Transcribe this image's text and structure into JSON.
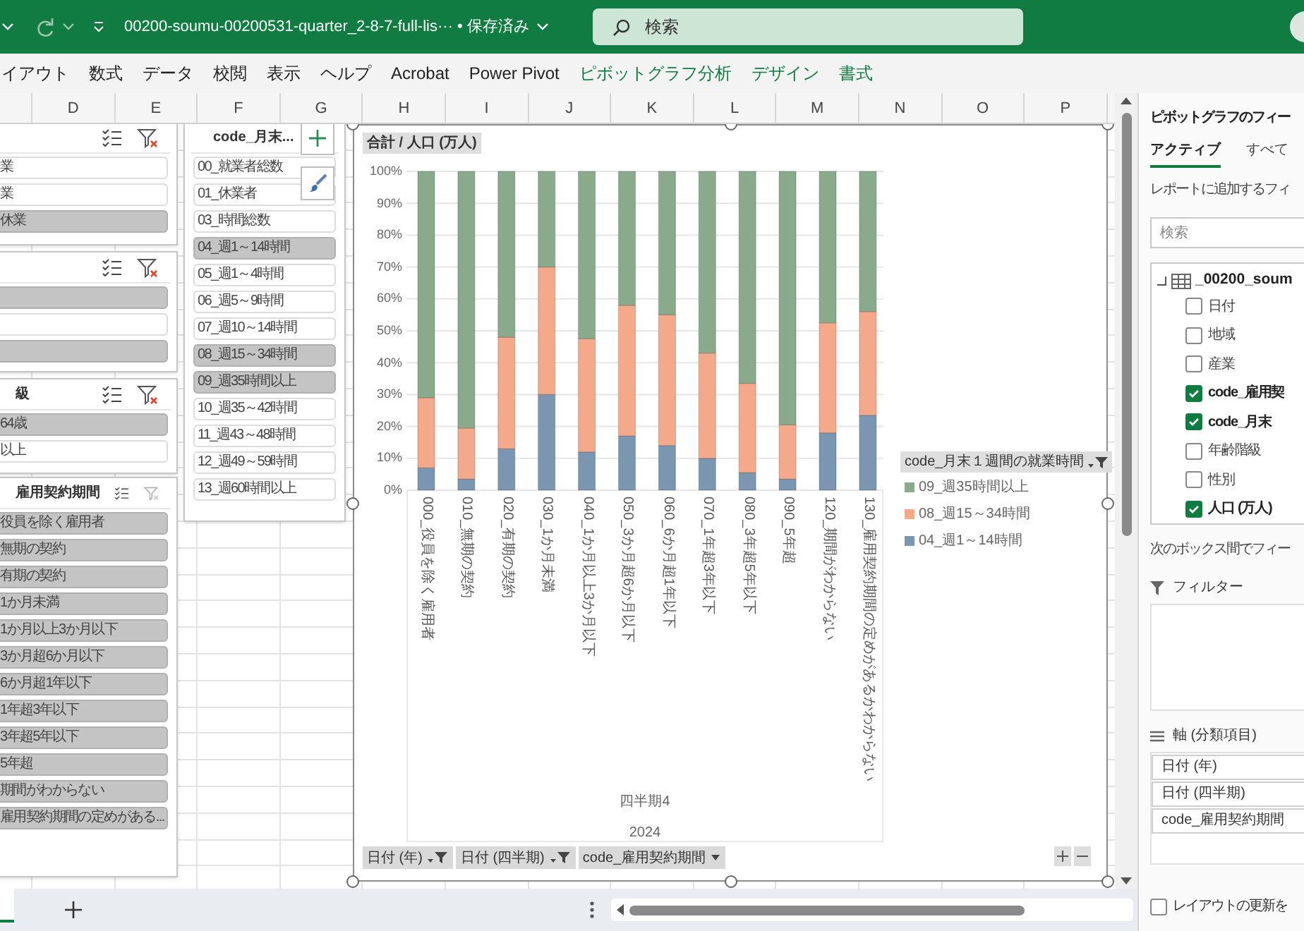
{
  "title_bar": {
    "file_name": "00200-soumu-00200531-quarter_2-8-7-full-lis···",
    "save_status": "• 保存済み",
    "search": {
      "placeholder": "検索"
    }
  },
  "ribbon_tabs": [
    {
      "label": "イアウト",
      "contextual": false
    },
    {
      "label": "数式",
      "contextual": false
    },
    {
      "label": "データ",
      "contextual": false
    },
    {
      "label": "校閲",
      "contextual": false
    },
    {
      "label": "表示",
      "contextual": false
    },
    {
      "label": "ヘルプ",
      "contextual": false
    },
    {
      "label": "Acrobat",
      "contextual": false
    },
    {
      "label": "Power Pivot",
      "contextual": false
    },
    {
      "label": "ピボットグラフ分析",
      "contextual": true
    },
    {
      "label": "デザイン",
      "contextual": true
    },
    {
      "label": "書式",
      "contextual": true
    }
  ],
  "column_headers": [
    "D",
    "E",
    "F",
    "G",
    "H",
    "I",
    "J",
    "K",
    "L",
    "M",
    "N",
    "O",
    "P"
  ],
  "slicers": [
    {
      "filtered": true,
      "items": [
        {
          "label": "業",
          "selected": false
        },
        {
          "label": "業",
          "selected": false
        },
        {
          "label": "休業",
          "selected": true
        }
      ]
    },
    {
      "filtered": true,
      "items": [
        {
          "selected": true
        },
        {
          "selected": false
        },
        {
          "selected": true
        }
      ]
    },
    {
      "header": "級",
      "filtered": true,
      "items": [
        {
          "label": "64歳",
          "selected": true
        },
        {
          "label": "以上",
          "selected": false
        }
      ]
    },
    {
      "header": "雇用契約期間",
      "filtered": false,
      "items": [
        {
          "label": "役員を除く雇用者",
          "selected": true
        },
        {
          "label": "無期の契約",
          "selected": true
        },
        {
          "label": "有期の契約",
          "selected": true
        },
        {
          "label": "1か月未満",
          "selected": true
        },
        {
          "label": "1か月以上3か月以下",
          "selected": true
        },
        {
          "label": "3か月超6か月以下",
          "selected": true
        },
        {
          "label": "6か月超1年以下",
          "selected": true
        },
        {
          "label": "1年超3年以下",
          "selected": true
        },
        {
          "label": "3年超5年以下",
          "selected": true
        },
        {
          "label": "5年超",
          "selected": true
        },
        {
          "label": "期間がわからない",
          "selected": true
        },
        {
          "label": "雇用契約期間の定めがある...",
          "selected": true
        }
      ]
    },
    {
      "header": "code_月末...",
      "items": [
        {
          "label": "00_就業者総数",
          "selected": false
        },
        {
          "label": "01_休業者",
          "selected": false
        },
        {
          "label": "03_時間総数",
          "selected": false
        },
        {
          "label": "04_週1～14時間",
          "selected": true
        },
        {
          "label": "05_週1～4時間",
          "selected": false
        },
        {
          "label": "06_週5～9時間",
          "selected": false
        },
        {
          "label": "07_週10～14時間",
          "selected": false
        },
        {
          "label": "08_週15～34時間",
          "selected": true
        },
        {
          "label": "09_週35時間以上",
          "selected": true
        },
        {
          "label": "10_週35～42時間",
          "selected": false
        },
        {
          "label": "11_週43～48時間",
          "selected": false
        },
        {
          "label": "12_週49～59時間",
          "selected": false
        },
        {
          "label": "13_週60時間以上",
          "selected": false
        }
      ]
    }
  ],
  "chart": {
    "value_button": "合計 / 人口 (万人)",
    "chart_data": {
      "type": "bar",
      "stacked": true,
      "grid": true,
      "legend": "right",
      "ylim": [
        0,
        100
      ],
      "yticks": [
        {
          "value": 0,
          "label": "0%"
        },
        {
          "value": 10,
          "label": "10%"
        },
        {
          "value": 20,
          "label": "20%"
        },
        {
          "value": 30,
          "label": "30%"
        },
        {
          "value": 40,
          "label": "40%"
        },
        {
          "value": 50,
          "label": "50%"
        },
        {
          "value": 60,
          "label": "60%"
        },
        {
          "value": 70,
          "label": "70%"
        },
        {
          "value": 80,
          "label": "80%"
        },
        {
          "value": 90,
          "label": "90%"
        },
        {
          "value": 100,
          "label": "100%"
        }
      ],
      "categories": [
        "000_役員を除く雇用者",
        "010_無期の契約",
        "020_有期の契約",
        "030_1か月未満",
        "040_1か月以上3か月以下",
        "050_3か月超6か月以下",
        "060_6か月超1年以下",
        "070_1年超3年以下",
        "080_3年超5年以下",
        "090_5年超",
        "120_期間がわからない",
        "130_雇用契約期間の定めがあるかわからない"
      ],
      "series": [
        {
          "name": "04_週1～14時間",
          "color": "#7a96b0",
          "values": [
            7,
            3.5,
            13,
            30,
            12,
            17,
            14,
            10,
            5.5,
            3.5,
            18,
            23.5
          ]
        },
        {
          "name": "08_週15～34時間",
          "color": "#f4a98a",
          "values": [
            22,
            16,
            35,
            40,
            35.5,
            41,
            41,
            33,
            28,
            17,
            34.5,
            32.5
          ]
        },
        {
          "name": "09_週35時間以上",
          "color": "#8aab8b",
          "values": [
            71,
            80.5,
            52,
            30,
            52.5,
            42,
            45,
            57,
            66.5,
            79.5,
            47.5,
            44
          ]
        }
      ]
    },
    "group_labels": [
      "四半期4",
      "2024"
    ],
    "legend_button": {
      "label": "code_月末１週間の就業時間",
      "filtered": true
    },
    "field_buttons": [
      {
        "label": "日付 (年)",
        "filtered": true
      },
      {
        "label": "日付 (四半期)",
        "filtered": true
      },
      {
        "label": "code_雇用契約期間",
        "filtered": false
      }
    ]
  },
  "field_pane": {
    "title": "ピボットグラフのフィー",
    "tabs": [
      {
        "label": "アクティブ",
        "selected": true
      },
      {
        "label": "すべて",
        "selected": false
      }
    ],
    "instruction": "レポートに追加するフィ",
    "search": {
      "placeholder": "検索"
    },
    "table_name": "_00200_soum",
    "fields": [
      {
        "label": "日付",
        "checked": false
      },
      {
        "label": "地域",
        "checked": false
      },
      {
        "label": "産業",
        "checked": false
      },
      {
        "label": "code_雇用契",
        "checked": true
      },
      {
        "label": "code_月末",
        "checked": true
      },
      {
        "label": "年齢階級",
        "checked": false
      },
      {
        "label": "性別",
        "checked": false
      },
      {
        "label": "人口 (万人)",
        "checked": true
      }
    ],
    "areas_hint": "次のボックス間でフィー",
    "filter_area": {
      "label": "フィルター"
    },
    "axis_area": {
      "label": "軸 (分類項目)",
      "items": [
        "日付 (年)",
        "日付 (四半期)",
        "code_雇用契約期間"
      ]
    },
    "defer_update": {
      "label": "レイアウトの更新を",
      "checked": false
    }
  }
}
